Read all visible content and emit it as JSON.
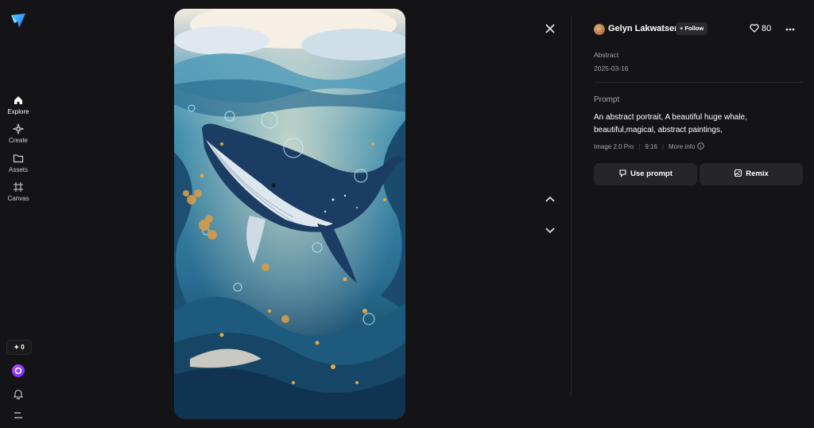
{
  "sidebar": {
    "items": [
      {
        "label": "Explore",
        "icon": "home-icon"
      },
      {
        "label": "Create",
        "icon": "sparkle-icon"
      },
      {
        "label": "Assets",
        "icon": "folder-icon"
      },
      {
        "label": "Canvas",
        "icon": "frame-icon"
      }
    ],
    "credits": "✦ 0"
  },
  "artwork": {
    "subject": "whale-illustration"
  },
  "panel": {
    "author": "Gelyn Lakwatsera",
    "follow_label": "+ Follow",
    "likes": "80",
    "category": "Abstract",
    "date": "2025-03-16",
    "prompt_label": "Prompt",
    "prompt_text": "An abstract portrait, A beautiful huge whale, beautiful,magical, abstract paintings,",
    "model": "Image 2.0 Pro",
    "ratio": "9:16",
    "more_info": "More info",
    "use_prompt_label": "Use prompt",
    "remix_label": "Remix"
  },
  "colors": {
    "background": "#141416",
    "button_bg": "#25252a",
    "accent_purple": "#8a3cff"
  }
}
